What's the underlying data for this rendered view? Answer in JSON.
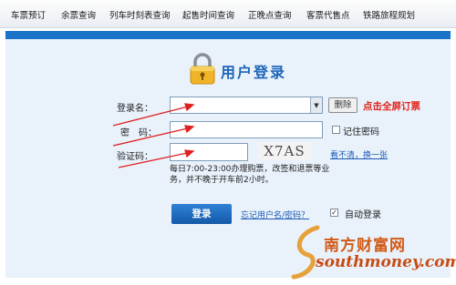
{
  "nav": {
    "items": [
      "车票预订",
      "余票查询",
      "列车时刻表查询",
      "起售时间查询",
      "正晚点查询",
      "客票代售点",
      "铁路旅程规划"
    ]
  },
  "login": {
    "title": "用户登录",
    "username_label": "登录名：",
    "username_value": "",
    "delete_button": "删除",
    "fullscreen_link": "点击全屏订票",
    "password_label": "密　码：",
    "remember_password": "记住密码",
    "captcha_label": "验证码：",
    "captcha_text": "X7AS",
    "refresh_captcha": "看不清，换一张",
    "hint": "每日7:00-23:00办理购票，改签和退票等业务，并不晚于开车前2小时。",
    "login_button": "登录",
    "forgot_link": "忘记用户名/密码？",
    "auto_login": "自动登录",
    "auto_login_checked": true
  },
  "watermark": {
    "text": "南方财富网",
    "url": "southmoney.com"
  },
  "colors": {
    "accent": "#1a73c8",
    "panel": "#e9f2fb",
    "red": "#e0231c"
  },
  "icons": [
    "lock-icon",
    "dropdown-arrow-icon",
    "checkbox-icon",
    "arrow-annotation-icon"
  ]
}
